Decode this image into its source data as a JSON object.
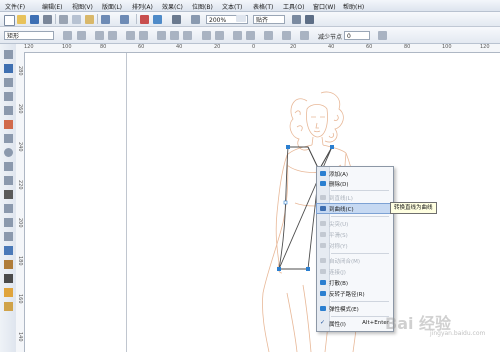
{
  "menubar": {
    "items": [
      "文件(F)",
      "编辑(E)",
      "视图(V)",
      "版面(L)",
      "排列(A)",
      "效果(C)",
      "位图(B)",
      "文本(T)",
      "表格(T)",
      "工具(O)",
      "窗口(W)",
      "帮助(H)"
    ]
  },
  "toolbar1": {
    "zoom_value": "200%",
    "snap_label": "贴齐"
  },
  "toolbar2": {
    "preset_value": "矩形",
    "reduce_nodes_label": "减少节点",
    "reduce_nodes_value": "0"
  },
  "ruler": {
    "h_ticks": [
      "120",
      "100",
      "80",
      "60",
      "40",
      "20",
      "0",
      "20",
      "40",
      "60",
      "80",
      "100",
      "120"
    ],
    "v_ticks": [
      "280",
      "260",
      "240",
      "220",
      "200",
      "180",
      "160",
      "140"
    ]
  },
  "context_menu": {
    "items": [
      {
        "label": "添加(A)",
        "enabled": true,
        "icon": "add-node-icon"
      },
      {
        "label": "删除(D)",
        "enabled": true,
        "icon": "delete-node-icon"
      },
      {
        "label": "到直线(L)",
        "enabled": false,
        "icon": "to-line-icon"
      },
      {
        "label": "到曲线(C)",
        "enabled": true,
        "icon": "to-curve-icon",
        "highlighted": true
      },
      {
        "label": "尖突(U)",
        "enabled": false,
        "icon": "cusp-icon"
      },
      {
        "label": "平滑(S)",
        "enabled": false,
        "icon": "smooth-icon"
      },
      {
        "label": "对称(Y)",
        "enabled": false,
        "icon": "symmetrical-icon"
      },
      {
        "label": "自动闭合(M)",
        "enabled": false,
        "icon": "auto-close-icon"
      },
      {
        "label": "连接(J)",
        "enabled": false,
        "icon": "join-icon"
      },
      {
        "label": "打散(B)",
        "enabled": true,
        "icon": "break-icon"
      },
      {
        "label": "反转子路径(R)",
        "enabled": true,
        "icon": "reverse-icon"
      },
      {
        "label": "弹性模式(E)",
        "enabled": true,
        "icon": "elastic-icon"
      },
      {
        "label": "属性(I)",
        "enabled": true,
        "checked": true,
        "shortcut": "Alt+Enter"
      }
    ]
  },
  "tooltip": {
    "text": "转换直线为曲线"
  },
  "watermark": {
    "text": "Bai 经验",
    "sub": "jingyan.baidu.com"
  },
  "colors": {
    "sketch_stroke": "#e8b898",
    "selected_path": "#4d4d4d",
    "node_fill": "#2b7fd0",
    "menu_highlight": "#c6d9f2"
  }
}
